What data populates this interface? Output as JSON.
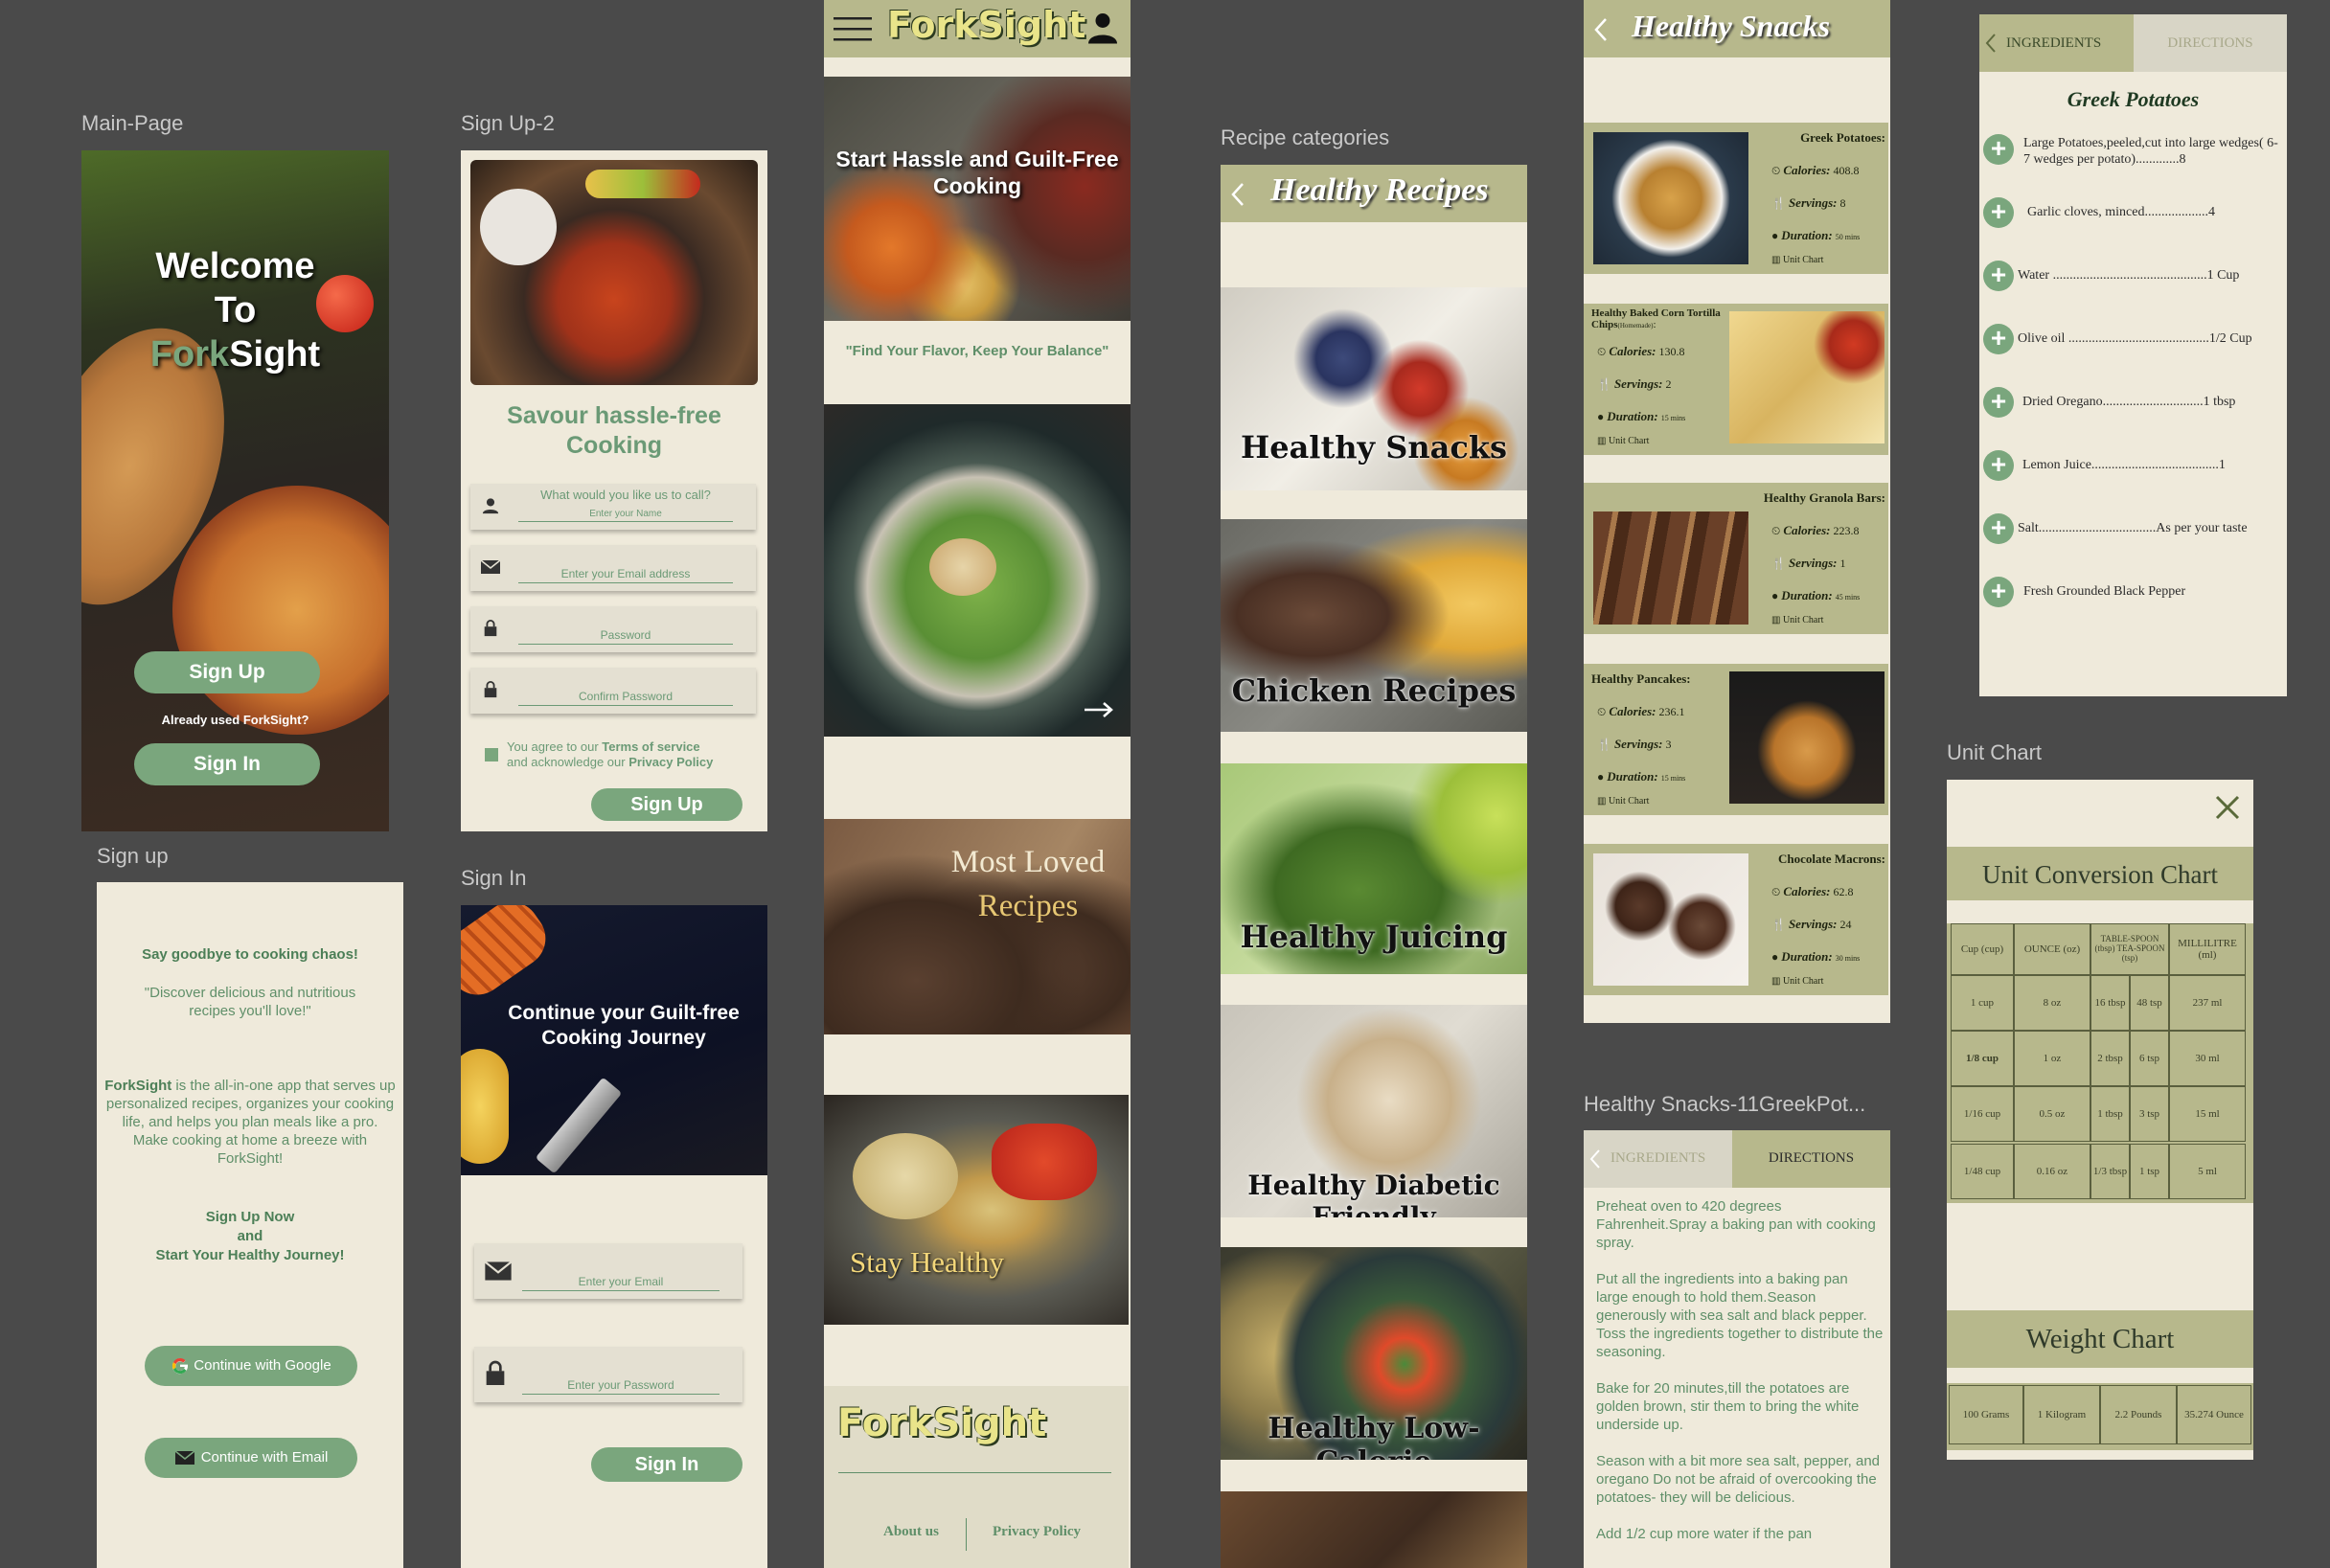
{
  "labels": {
    "main_page": "Main-Page",
    "sign_up_2": "Sign Up-2",
    "sign_up": "Sign up",
    "sign_in": "Sign In",
    "recipe_categories": "Recipe categories",
    "snack_detail": "Healthy Snacks-11GreekPot...",
    "unit_chart": "Unit Chart"
  },
  "main_page": {
    "welcome_line1": "Welcome",
    "welcome_line2": "To",
    "brand_fork": "Fork",
    "brand_sight": "Sight",
    "sign_up": "Sign Up",
    "already": "Already used ForkSight?",
    "sign_in": "Sign In"
  },
  "signup2": {
    "heading": "Savour hassle-free Cooking",
    "name_label": "What would you like us to call?",
    "name_placeholder": "Enter your Name",
    "email_placeholder": "Enter your Email address",
    "password_placeholder": "Password",
    "confirm_placeholder": "Confirm Password",
    "agree_prefix": "You agree to our ",
    "terms": "Terms of service",
    "agree_mid": "and acknowledge our ",
    "privacy": "Privacy Policy",
    "button": "Sign Up"
  },
  "signup": {
    "headline": "Say goodbye to cooking chaos!",
    "quote": "\"Discover delicious and nutritious recipes you'll love!\"",
    "brand": "ForkSight",
    "body": " is the all-in-one app that serves up personalized recipes, organizes your cooking life, and helps you plan meals like a pro. Make cooking at home a breeze with ForkSight!",
    "cta1": "Sign Up Now",
    "cta2": "and",
    "cta3": "Start Your Healthy Journey!",
    "google": "Continue with Google",
    "email": "Continue with Email"
  },
  "signin": {
    "hero": "Continue your Guilt-free Cooking  Journey",
    "email_placeholder": "Enter your Email",
    "password_placeholder": "Enter your Password",
    "button": "Sign In"
  },
  "home": {
    "brand": "ForkSight",
    "hero": "Start Hassle and Guilt-Free Cooking",
    "tagline": "\"Find Your Flavor, Keep Your Balance\"",
    "most_loved_1": "Most Loved",
    "most_loved_2": "Recipes",
    "stay_healthy": "Stay Healthy",
    "footer_brand": "ForkSight",
    "about": "About us",
    "privacy": "Privacy Policy"
  },
  "categories": {
    "title": "Healthy Recipes",
    "items": [
      "Healthy Snacks",
      "Chicken Recipes",
      "Healthy Juicing",
      "Healthy Diabetic Friendly",
      "Healthy Low-Calorie"
    ]
  },
  "snacks": {
    "title": "Healthy Snacks",
    "cal_label": "Calories:",
    "serv_label": "Servings:",
    "dur_label": "Duration:",
    "unit_chart": "Unit Chart",
    "items": [
      {
        "name": "Greek Potatoes:",
        "calories": "408.8",
        "servings": "8",
        "duration": "50 mins"
      },
      {
        "name": "Healthy Baked Corn Tortilla Chips",
        "note": "(Homemade)",
        "calories": "130.8",
        "servings": "2",
        "duration": "15 mins"
      },
      {
        "name": "Healthy Granola Bars:",
        "calories": "223.8",
        "servings": "1",
        "duration": "45 mins"
      },
      {
        "name": "Healthy Pancakes:",
        "calories": "236.1",
        "servings": "3",
        "duration": "15 mins"
      },
      {
        "name": "Chocolate Macrons:",
        "calories": "62.8",
        "servings": "24",
        "duration": "30 mins"
      }
    ]
  },
  "directions": {
    "tab_ingredients": "INGREDIENTS",
    "tab_directions": "DIRECTIONS",
    "steps": [
      "Preheat oven to 420 degrees Fahrenheit.Spray a baking pan with cooking spray.",
      "Put all the ingredients into a baking pan large enough to hold them.Season generously with sea salt and black pepper. Toss the ingredients together to distribute the seasoning.",
      "Bake for 20 minutes,till the potatoes are golden brown, stir them to bring the white underside up.",
      "Season with a bit more sea salt, pepper, and oregano Do not be afraid of overcooking the potatoes- they will be delicious.",
      "Add 1/2 cup more water if the pan"
    ]
  },
  "ingredients": {
    "tab_ingredients": "INGREDIENTS",
    "tab_directions": "DIRECTIONS",
    "title": "Greek Potatoes",
    "items": [
      "Large Potatoes,peeled,cut into large wedges( 6-7 wedges per potato).............8",
      "Garlic cloves, minced...................4",
      "Water ..............................................1 Cup",
      "Olive oil ..........................................1/2 Cup",
      "Dried Oregano..............................1 tbsp",
      "Lemon Juice......................................1",
      "Salt...................................As per your taste",
      "Fresh Grounded Black Pepper"
    ]
  },
  "unit_chart": {
    "title": "Unit Conversion Chart",
    "headers": [
      "Cup (cup)",
      "OUNCE (oz)",
      "TABLE-SPOON (tbsp) TEA-SPOON (tsp)",
      "MILLILITRE (ml)"
    ],
    "rows": [
      [
        "1 cup",
        "8 oz",
        "16 tbsp",
        "48 tsp",
        "237 ml"
      ],
      [
        "1/8 cup",
        "1 oz",
        "2 tbsp",
        "6 tsp",
        "30 ml"
      ],
      [
        "1/16 cup",
        "0.5 oz",
        "1 tbsp",
        "3 tsp",
        "15 ml"
      ],
      [
        "1/48 cup",
        "0.16 oz",
        "1/3 tbsp",
        "1 tsp",
        "5 ml"
      ]
    ],
    "weight_title": "Weight Chart",
    "weight": [
      "100 Grams",
      "1 Kilogram",
      "2.2 Pounds",
      "35.274 Ounce"
    ]
  },
  "colors": {
    "background": "#4a4a4a",
    "cream": "#efeadb",
    "olive": "#b7b88c",
    "green": "#7aa67d",
    "text_green": "#5f8f69"
  }
}
